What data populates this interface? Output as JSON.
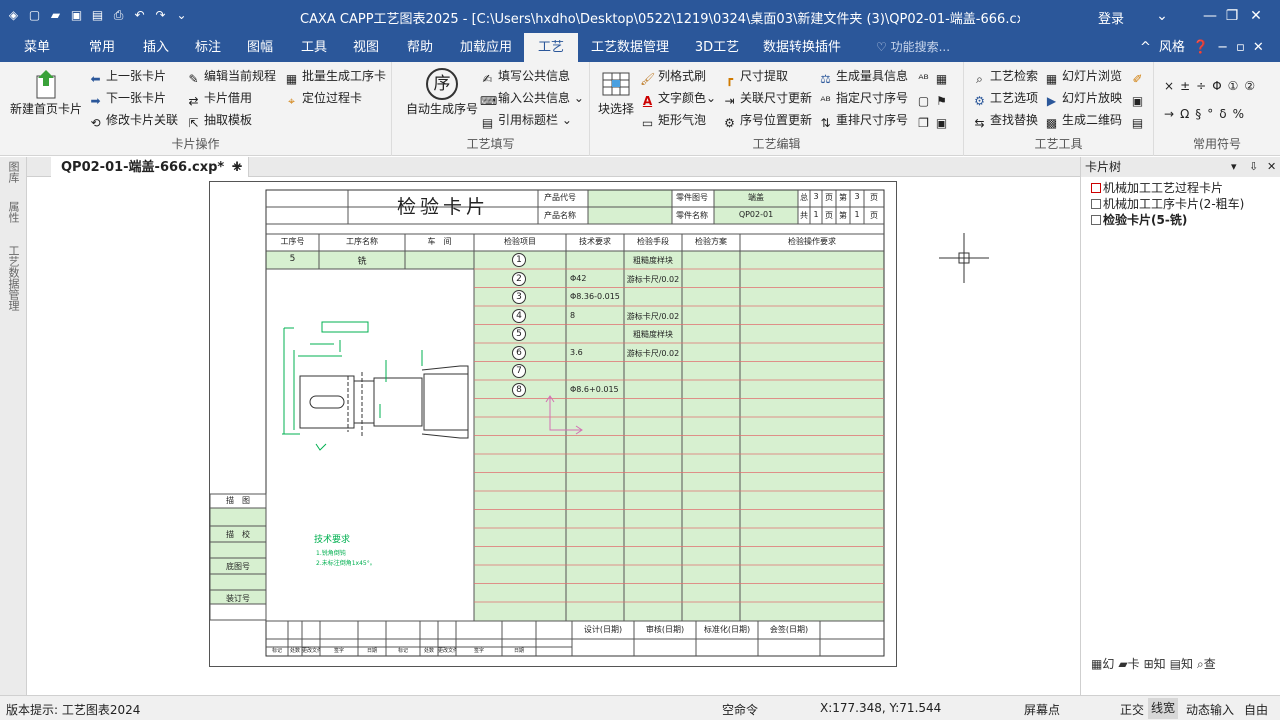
{
  "title_bar": {
    "title": "CAXA CAPP工艺图表2025 - [C:\\Users\\hxdho\\Desktop\\0522\\1219\\0324\\桌面03\\新建文件夹 (3)\\QP02-01-端盖-666.cxp*]",
    "login": "登录"
  },
  "menu_tabs": [
    "菜单",
    "常用",
    "插入",
    "标注",
    "图幅",
    "工具",
    "视图",
    "帮助",
    "加载应用",
    "工艺",
    "工艺数据管理",
    "3D工艺",
    "数据转换插件"
  ],
  "active_tab": "工艺",
  "search_placeholder": "功能搜索...",
  "style_label": "风格",
  "ribbon": {
    "card_ops": {
      "label": "卡片操作",
      "new_first": "新建首页卡片",
      "prev": "上一张卡片",
      "next": "下一张卡片",
      "modify_link": "修改卡片关联",
      "edit_rule": "编辑当前规程",
      "borrow": "卡片借用",
      "extract": "抽取模板",
      "batch_gen": "批量生成工序卡",
      "locate": "定位过程卡"
    },
    "fill": {
      "label": "工艺填写",
      "auto_seq": "自动生成序号",
      "seq_char": "序",
      "write_public": "填写公共信息",
      "input_public": "输入公共信息",
      "ref_title": "引用标题栏"
    },
    "edit": {
      "label": "工艺编辑",
      "block_select": "块选择",
      "col_format": "列格式刷",
      "text_color": "文字颜色",
      "rect_bubble": "矩形气泡",
      "dim_extract": "尺寸提取",
      "link_dim_update": "关联尺寸更新",
      "seq_pos_update": "序号位置更新",
      "gen_tool": "生成量具信息",
      "assign_dim": "指定尺寸序号",
      "rearrange_dim": "重排尺寸序号"
    },
    "tools": {
      "label": "工艺工具",
      "search": "工艺检索",
      "options": "工艺选项",
      "find_replace": "查找替换",
      "slide_browse": "幻灯片浏览",
      "slide_play": "幻灯片放映",
      "gen_qr": "生成二维码"
    },
    "symbols": {
      "label": "常用符号",
      "row1": [
        "×",
        "±",
        "÷",
        "Φ",
        "①",
        "②"
      ],
      "row2": [
        "→",
        "Ω",
        "§",
        "°",
        "δ",
        "%"
      ]
    }
  },
  "left_dock": [
    "图库",
    "属性",
    "工艺数据管理"
  ],
  "doc_tab": "QP02-01-端盖-666.cxp*",
  "sheet": {
    "card_title": "检验卡片",
    "prod_code_label": "产品代号",
    "prod_name_label": "产品名称",
    "part_no_label": "零件图号",
    "part_name_label": "零件名称",
    "part_name_value": "端盖",
    "part_no_value": "QP02-01",
    "total_label": "总",
    "total_value": "3",
    "page_label": "页",
    "sheet_label": "第",
    "sheet_value": "3",
    "sub_total_label": "共",
    "sub_total_value": "1",
    "sub_sheet_label": "第",
    "sub_sheet_value": "1",
    "headers": [
      "工序号",
      "工序名称",
      "车　间",
      "检验项目",
      "技术要求",
      "检验手段",
      "检验方案",
      "检验操作要求"
    ],
    "op_no": "5",
    "op_name": "铣",
    "rows": [
      {
        "n": "1",
        "req": "",
        "tool": "粗糙度样块"
      },
      {
        "n": "2",
        "req": "Φ42",
        "tool": "游标卡尺/0.02"
      },
      {
        "n": "3",
        "req": "Φ8.36-0.015",
        "tool": ""
      },
      {
        "n": "4",
        "req": "8",
        "tool": "游标卡尺/0.02"
      },
      {
        "n": "5",
        "req": "",
        "tool": "粗糙度样块"
      },
      {
        "n": "6",
        "req": "3.6",
        "tool": "游标卡尺/0.02"
      },
      {
        "n": "7",
        "req": "",
        "tool": ""
      },
      {
        "n": "8",
        "req": "Φ8.6+0.015",
        "tool": ""
      }
    ],
    "side_labels": [
      "描　图",
      "描　校",
      "底图号",
      "装订号"
    ],
    "tech_title": "技术要求",
    "tech_lines": [
      "1.锐角倒钝",
      "2.未标注倒角1x45°。"
    ],
    "sign_labels": [
      "设计(日期)",
      "审核(日期)",
      "标准化(日期)",
      "会签(日期)"
    ],
    "rev_labels": [
      "标记",
      "处数",
      "更改文件号",
      "签字",
      "日期",
      "标记",
      "处数",
      "更改文件号",
      "签字",
      "日期"
    ]
  },
  "right_panel": {
    "title": "卡片树",
    "items": [
      "机械加工工艺过程卡片",
      "机械加工工序卡片(2-粗车)",
      "检验卡片(5-铣)"
    ],
    "tabs": [
      "幻",
      "卡",
      "知",
      "知",
      "查"
    ]
  },
  "status": {
    "hint": "版本提示:  工艺图表2024",
    "command": "空命令",
    "coords": "X:177.348, Y:71.544",
    "snap": "屏幕点",
    "ortho": "正交",
    "linewidth": "线宽",
    "dynamic": "动态输入",
    "free": "自由"
  },
  "colors": {
    "title_bg": "#2b579a",
    "ribbon_bg": "#f3f3f3",
    "cell_green": "#d7f0d0",
    "grid_red": "#e07070",
    "drawing_green": "#00b050"
  }
}
